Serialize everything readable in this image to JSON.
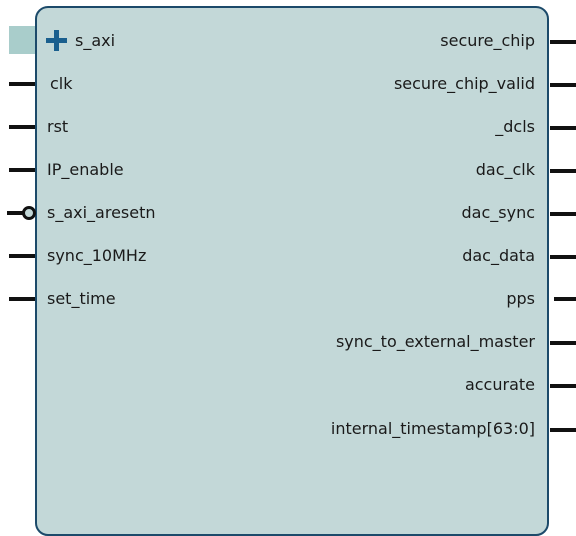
{
  "block": {
    "left_ports": [
      {
        "name": "s_axi",
        "kind": "bus"
      },
      {
        "name": "clk",
        "kind": "pin"
      },
      {
        "name": "rst",
        "kind": "pin"
      },
      {
        "name": "IP_enable",
        "kind": "pin"
      },
      {
        "name": "s_axi_aresetn",
        "kind": "active-low"
      },
      {
        "name": "sync_10MHz",
        "kind": "pin"
      },
      {
        "name": "set_time",
        "kind": "pin"
      }
    ],
    "right_ports": [
      {
        "name": "secure_chip"
      },
      {
        "name": "secure_chip_valid"
      },
      {
        "name": "_dcls"
      },
      {
        "name": "dac_clk"
      },
      {
        "name": "dac_sync"
      },
      {
        "name": "dac_data"
      },
      {
        "name": "pps"
      },
      {
        "name": "sync_to_external_master"
      },
      {
        "name": "accurate"
      },
      {
        "name": "internal_timestamp[63:0]"
      }
    ]
  },
  "colors": {
    "block_fill": "#c3d8d8",
    "block_border": "#1c4a6a",
    "bus_highlight": "#a9cdcb",
    "plus_icon": "#1a5f8e",
    "pin": "#111111"
  }
}
